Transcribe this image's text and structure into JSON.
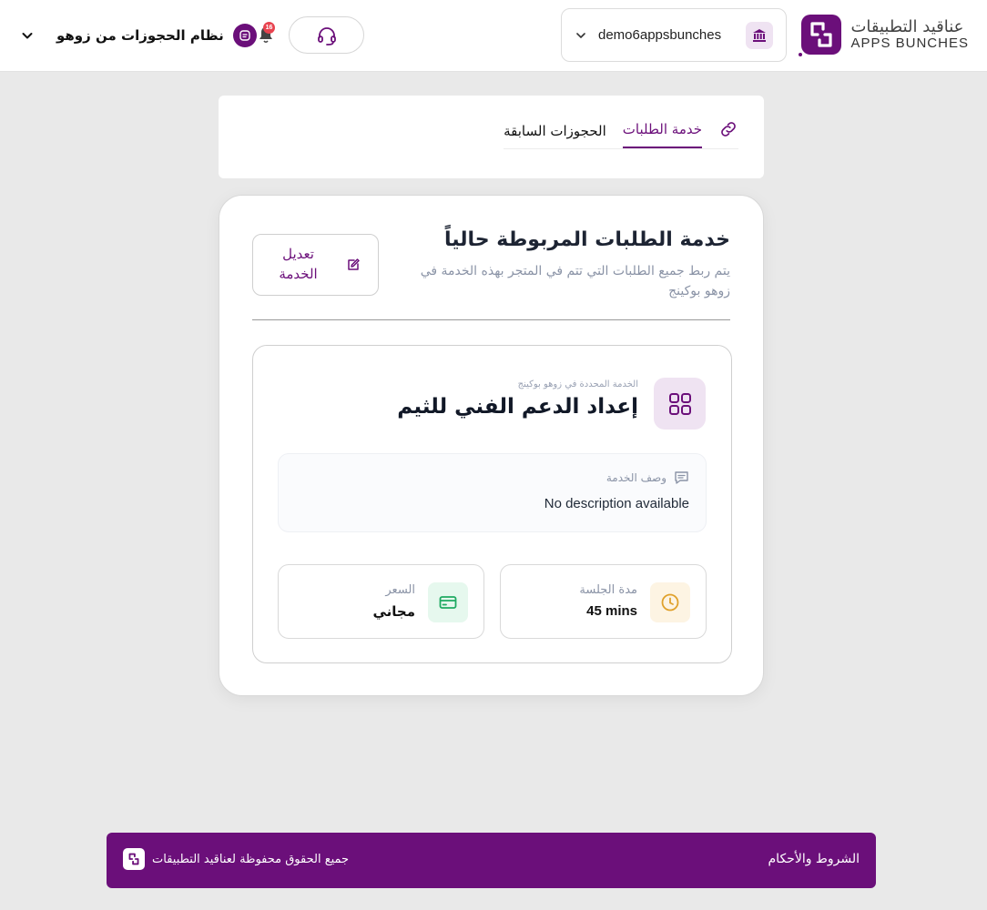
{
  "header": {
    "logo": {
      "text_ar": "عناقيد التطبيقات",
      "text_en": "APPS BUNCHES",
      "icon": "apps-bunches-logo-icon",
      "color": "#6b0f7a"
    },
    "account": {
      "name": "demo6appsbunches",
      "icon": "bank-icon"
    },
    "support": {
      "icon": "headset-icon"
    },
    "notifications": {
      "count": "16",
      "icon": "bell-icon"
    },
    "app": {
      "name": "نظام الحجوزات من زوهو",
      "icon": "zoho-bookings-icon"
    }
  },
  "tabs": [
    {
      "label": "خدمة الطلبات",
      "active": true,
      "icon": "link-icon"
    },
    {
      "label": "الحجوزات السابقة",
      "active": false
    }
  ],
  "main": {
    "title": "خدمة الطلبات المربوطة حالياً",
    "subtitle": "يتم ربط جميع الطلبات التي تتم في المتجر بهذه الخدمة في زوهو بوكينج",
    "edit_button": {
      "label": "تعديل الخدمة",
      "icon": "edit-icon"
    },
    "service": {
      "caption": "الخدمة المحددة في زوهو بوكينج",
      "name": "إعداد الدعم الفني للثيم",
      "icon": "grid-icon"
    },
    "description": {
      "label": "وصف الخدمة",
      "value": "No description available",
      "icon": "comment-icon"
    },
    "duration": {
      "label": "مدة الجلسة",
      "value": "45 mins",
      "icon": "clock-icon"
    },
    "price": {
      "label": "السعر",
      "value": "مجاني",
      "icon": "credit-card-icon"
    }
  },
  "footer": {
    "terms": "الشروط والأحكام",
    "copyright": "جميع الحقوق محفوظة لعناقيد التطبيقات",
    "icon": "apps-bunches-logo-icon"
  },
  "colors": {
    "brand": "#6b0f7a",
    "background": "#e9e9e9",
    "badge": "#e8434f",
    "duration_accent": "#e0a12b",
    "price_accent": "#1faa62"
  }
}
